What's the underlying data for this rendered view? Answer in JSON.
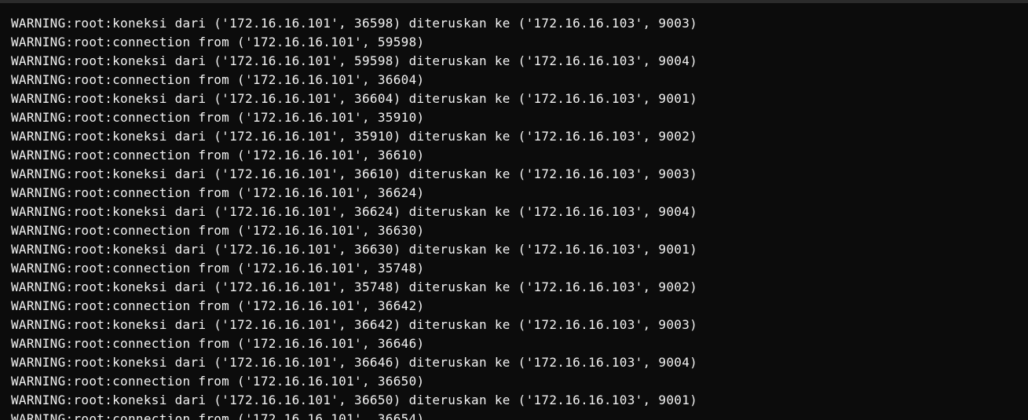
{
  "terminal": {
    "lines": [
      "WARNING:root:koneksi dari ('172.16.16.101', 36598) diteruskan ke ('172.16.16.103', 9003)",
      "WARNING:root:connection from ('172.16.16.101', 59598)",
      "WARNING:root:koneksi dari ('172.16.16.101', 59598) diteruskan ke ('172.16.16.103', 9004)",
      "WARNING:root:connection from ('172.16.16.101', 36604)",
      "WARNING:root:koneksi dari ('172.16.16.101', 36604) diteruskan ke ('172.16.16.103', 9001)",
      "WARNING:root:connection from ('172.16.16.101', 35910)",
      "WARNING:root:koneksi dari ('172.16.16.101', 35910) diteruskan ke ('172.16.16.103', 9002)",
      "WARNING:root:connection from ('172.16.16.101', 36610)",
      "WARNING:root:koneksi dari ('172.16.16.101', 36610) diteruskan ke ('172.16.16.103', 9003)",
      "WARNING:root:connection from ('172.16.16.101', 36624)",
      "WARNING:root:koneksi dari ('172.16.16.101', 36624) diteruskan ke ('172.16.16.103', 9004)",
      "WARNING:root:connection from ('172.16.16.101', 36630)",
      "WARNING:root:koneksi dari ('172.16.16.101', 36630) diteruskan ke ('172.16.16.103', 9001)",
      "WARNING:root:connection from ('172.16.16.101', 35748)",
      "WARNING:root:koneksi dari ('172.16.16.101', 35748) diteruskan ke ('172.16.16.103', 9002)",
      "WARNING:root:connection from ('172.16.16.101', 36642)",
      "WARNING:root:koneksi dari ('172.16.16.101', 36642) diteruskan ke ('172.16.16.103', 9003)",
      "WARNING:root:connection from ('172.16.16.101', 36646)",
      "WARNING:root:koneksi dari ('172.16.16.101', 36646) diteruskan ke ('172.16.16.103', 9004)",
      "WARNING:root:connection from ('172.16.16.101', 36650)",
      "WARNING:root:koneksi dari ('172.16.16.101', 36650) diteruskan ke ('172.16.16.103', 9001)",
      "WARNING:root:connection from ('172.16.16.101', 36654)"
    ]
  },
  "colors": {
    "background": "#0c0c0c",
    "foreground": "#f2f2f2"
  }
}
